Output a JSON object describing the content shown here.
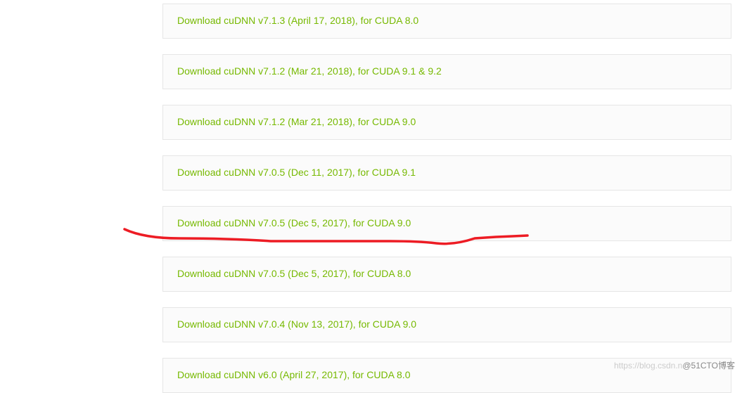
{
  "downloads": [
    {
      "label": "Download cuDNN v7.1.3 (April 17, 2018), for CUDA 8.0"
    },
    {
      "label": "Download cuDNN v7.1.2 (Mar 21, 2018), for CUDA 9.1 & 9.2"
    },
    {
      "label": "Download cuDNN v7.1.2 (Mar 21, 2018), for CUDA 9.0"
    },
    {
      "label": "Download cuDNN v7.0.5 (Dec 11, 2017), for CUDA 9.1"
    },
    {
      "label": "Download cuDNN v7.0.5 (Dec 5, 2017), for CUDA 9.0"
    },
    {
      "label": "Download cuDNN v7.0.5 (Dec 5, 2017), for CUDA 8.0"
    },
    {
      "label": "Download cuDNN v7.0.4 (Nov 13, 2017), for CUDA 9.0"
    },
    {
      "label": "Download cuDNN v6.0 (April 27, 2017), for CUDA 8.0"
    }
  ],
  "watermark": {
    "light": "https://blog.csdn.n",
    "dark": "@51CTO博客"
  }
}
